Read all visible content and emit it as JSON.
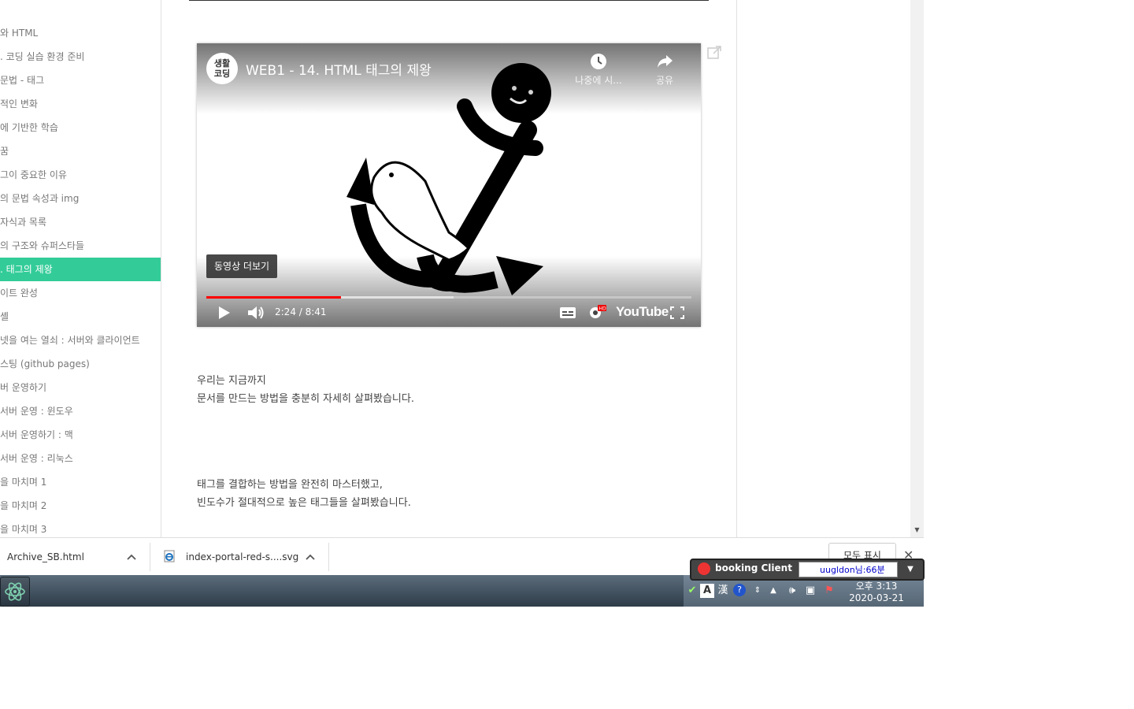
{
  "sidebar": {
    "items": [
      {
        "label": "와 HTML"
      },
      {
        "label": ". 코딩 실습 환경 준비"
      },
      {
        "label": "문법 - 태그"
      },
      {
        "label": "적인 변화"
      },
      {
        "label": "에 기반한 학습"
      },
      {
        "label": "꿈"
      },
      {
        "label": "그이 중요한 이유"
      },
      {
        "label": "의 문법 속성과 img"
      },
      {
        "label": "자식과 목록"
      },
      {
        "label": "의 구조와 슈퍼스타들"
      },
      {
        "label": ". 태그의 제왕"
      },
      {
        "label": "이트 완성"
      },
      {
        "label": "셸"
      },
      {
        "label": "넷을 여는 열쇠 : 서버와 클라이언트"
      },
      {
        "label": "스팅 (github pages)"
      },
      {
        "label": "버 운영하기"
      },
      {
        "label": "서버 운영 : 윈도우"
      },
      {
        "label": "서버 운영하기 : 맥"
      },
      {
        "label": "서버 운영 : 리눅스"
      },
      {
        "label": "을 마치며 1"
      },
      {
        "label": "을 마치며 2"
      },
      {
        "label": "을 마치며 3"
      }
    ],
    "active_index": 10
  },
  "video": {
    "channel_avatar": "생활\n코딩",
    "title": "WEB1 - 14. HTML 태그의 제왕",
    "watch_later_label": "나중에 시...",
    "share_label": "공유",
    "more_videos_label": "동영상 더보기",
    "current_time": "2:24",
    "duration": "8:41",
    "time_display": "2:24 / 8:41",
    "played_fraction": 0.277,
    "buffered_fraction": 0.51,
    "logo": "YouTube",
    "accent_color": "#ff0000"
  },
  "content": {
    "para1_line1": "우리는 지금까지",
    "para1_line2": "문서를 만드는 방법을 충분히 자세히 살펴봤습니다.",
    "para2_line1": "태그를 결합하는 방법을 완전히 마스터했고,",
    "para2_line2": "빈도수가 절대적으로 높은 태그들을 살펴봤습니다."
  },
  "downloads": {
    "items": [
      {
        "name": "Archive_SB.html",
        "icon": "html-file-icon"
      },
      {
        "name": "index-portal-red-s....svg",
        "icon": "ie-file-icon"
      }
    ],
    "show_all_label": "모두 표시"
  },
  "taskbar": {
    "booking_label": "booking Client",
    "booking_field": "uugldon님:66분",
    "ime_mode_a": "A",
    "ime_mode_hanja": "漢",
    "clock_time": "오후 3:13",
    "clock_date": "2020-03-21"
  },
  "colors": {
    "sidebar_active": "#33cc99",
    "youtube_red": "#ff0000"
  }
}
